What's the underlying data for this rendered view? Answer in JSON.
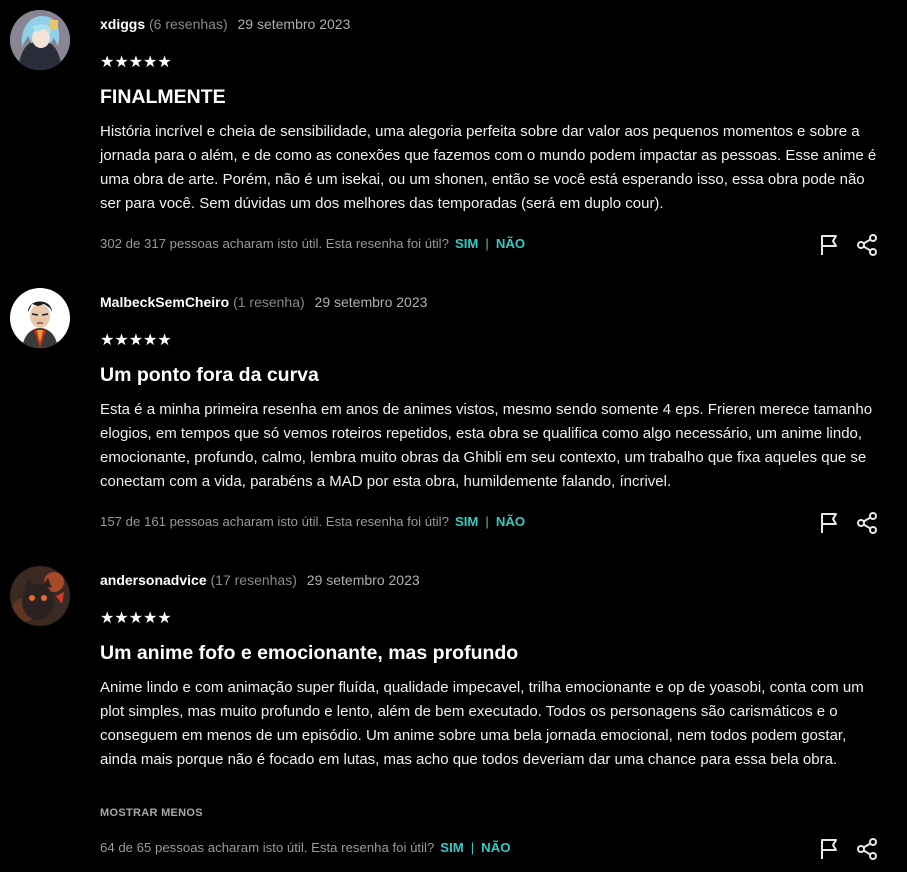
{
  "reviews": [
    {
      "username": "xdiggs",
      "review_count": "(6 resenhas)",
      "date": "29 setembro 2023",
      "stars": "★★★★★",
      "title": "FINALMENTE",
      "body": "História incrível e cheia de sensibilidade, uma alegoria perfeita sobre dar valor aos pequenos momentos e sobre a jornada para o além, e de como as conexões que fazemos com o mundo podem impactar as pessoas. Esse anime é uma obra de arte. Porém, não é um isekai, ou um shonen, então se você está esperando isso, essa obra pode não ser para você. Sem dúvidas um dos melhores das temporadas (será em duplo cour).",
      "helpful_text": "302 de 317 pessoas acharam isto útil. Esta resenha foi útil?",
      "yes_label": "SIM",
      "no_label": "NÃO",
      "show_less": ""
    },
    {
      "username": "MalbeckSemCheiro",
      "review_count": "(1 resenha)",
      "date": "29 setembro 2023",
      "stars": "★★★★★",
      "title": "Um ponto fora da curva",
      "body": "Esta é a minha primeira resenha em anos de animes vistos, mesmo sendo somente 4 eps. Frieren merece tamanho elogios, em tempos que só vemos roteiros repetidos, esta obra se qualifica como algo necessário, um anime lindo, emocionante, profundo, calmo, lembra muito obras da Ghibli em seu contexto, um trabalho que fixa aqueles que se conectam com a vida, parabéns a MAD por esta obra, humildemente falando, íncrivel.",
      "helpful_text": "157 de 161 pessoas acharam isto útil. Esta resenha foi útil?",
      "yes_label": "SIM",
      "no_label": "NÃO",
      "show_less": ""
    },
    {
      "username": "andersonadvice",
      "review_count": "(17 resenhas)",
      "date": "29 setembro 2023",
      "stars": "★★★★★",
      "title": "Um anime fofo e emocionante, mas profundo",
      "body": "Anime lindo e com animação super fluída, qualidade impecavel, trilha emocionante e op de yoasobi, conta com um plot simples, mas muito profundo e lento, além de bem executado. Todos os personagens são carismáticos e o conseguem em menos de um episódio. Um anime sobre uma bela jornada emocional, nem todos podem gostar, ainda mais porque não é focado em lutas, mas acho que todos deveriam dar uma chance para essa bela obra.",
      "helpful_text": "64 de 65 pessoas acharam isto útil. Esta resenha foi útil?",
      "yes_label": "SIM",
      "no_label": "NÃO",
      "show_less": "MOSTRAR MENOS"
    }
  ],
  "rating": {
    "value": 5,
    "max": 5
  },
  "icons": {
    "report": "flag-icon",
    "share": "share-icon"
  },
  "colors": {
    "accent": "#35c9c0",
    "background": "#000000"
  }
}
